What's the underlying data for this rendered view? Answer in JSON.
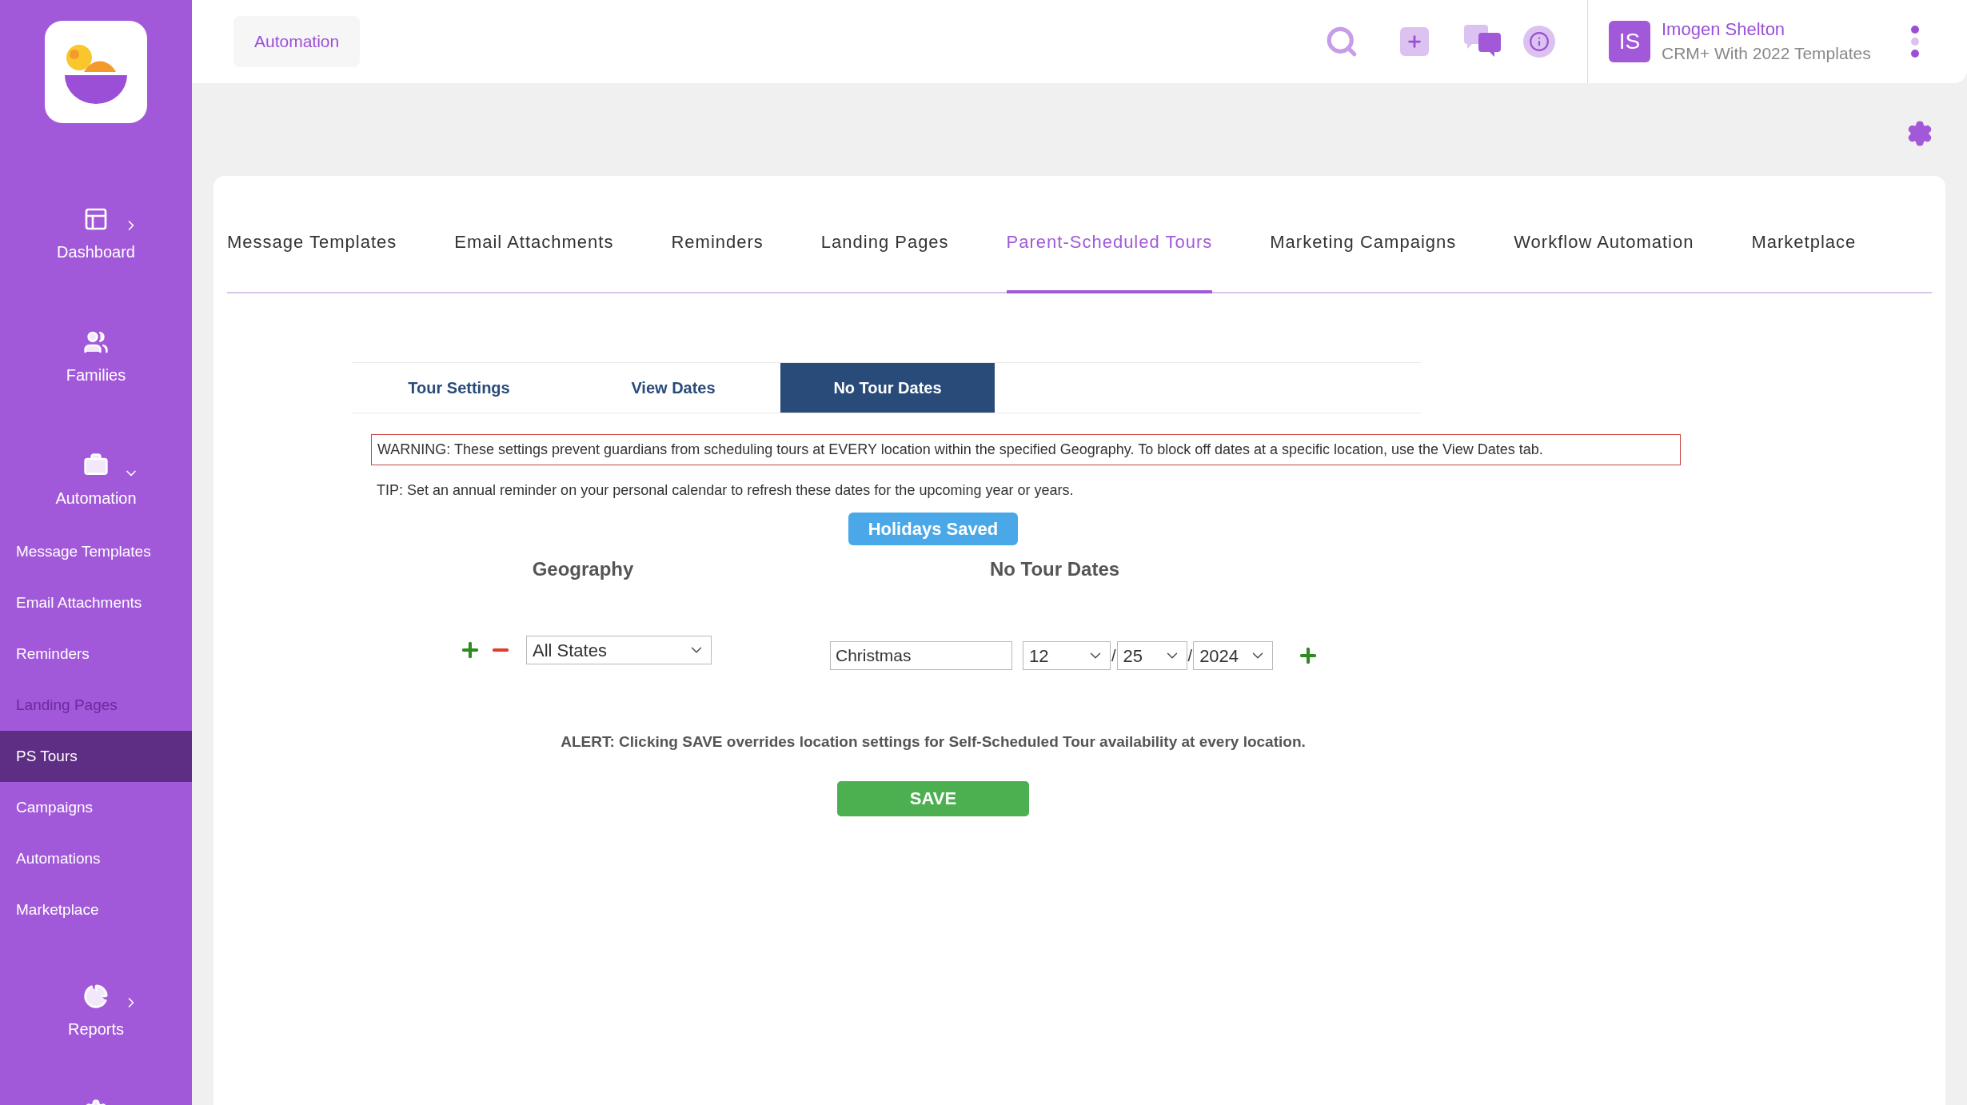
{
  "sidebar": {
    "sections": [
      {
        "label": "Dashboard",
        "kind": "expandable",
        "expanded": false
      },
      {
        "label": "Families",
        "kind": "link"
      },
      {
        "label": "Automation",
        "kind": "expandable",
        "expanded": true,
        "children": [
          {
            "label": "Message Templates",
            "selected": false,
            "disabled": false
          },
          {
            "label": "Email Attachments",
            "selected": false,
            "disabled": false
          },
          {
            "label": "Reminders",
            "selected": false,
            "disabled": false
          },
          {
            "label": "Landing Pages",
            "selected": false,
            "disabled": true
          },
          {
            "label": "PS Tours",
            "selected": true,
            "disabled": false
          },
          {
            "label": "Campaigns",
            "selected": false,
            "disabled": false
          },
          {
            "label": "Automations",
            "selected": false,
            "disabled": false
          },
          {
            "label": "Marketplace",
            "selected": false,
            "disabled": false
          }
        ]
      },
      {
        "label": "Reports",
        "kind": "expandable",
        "expanded": false
      }
    ]
  },
  "header": {
    "breadcrumb": "Automation",
    "user": {
      "initials": "IS",
      "name": "Imogen Shelton",
      "subtitle": "CRM+ With 2022 Templates"
    }
  },
  "tabs": [
    {
      "label": "Message Templates",
      "selected": false
    },
    {
      "label": "Email Attachments",
      "selected": false
    },
    {
      "label": "Reminders",
      "selected": false
    },
    {
      "label": "Landing Pages",
      "selected": false
    },
    {
      "label": "Parent-Scheduled Tours",
      "selected": true
    },
    {
      "label": "Marketing Campaigns",
      "selected": false
    },
    {
      "label": "Workflow Automation",
      "selected": false
    },
    {
      "label": "Marketplace",
      "selected": false
    }
  ],
  "subtabs": [
    {
      "label": "Tour Settings",
      "selected": false
    },
    {
      "label": "View Dates",
      "selected": false
    },
    {
      "label": "No Tour Dates",
      "selected": true
    }
  ],
  "warning": "WARNING: These settings prevent guardians from scheduling tours at EVERY location within the specified Geography. To block off dates at a specific location, use the View Dates tab.",
  "tip": "TIP: Set an annual reminder on your personal calendar to refresh these dates for the upcoming year or years.",
  "status_button": "Holidays Saved",
  "geography": {
    "heading": "Geography",
    "value": "All States"
  },
  "dates": {
    "heading": "No Tour Dates",
    "rows": [
      {
        "name": "Christmas",
        "month": "12",
        "day": "25",
        "year": "2024",
        "separators": [
          "/",
          "/"
        ]
      }
    ]
  },
  "alert": "ALERT: Clicking SAVE overrides location settings for Self-Scheduled Tour availability at every location.",
  "save": "SAVE"
}
